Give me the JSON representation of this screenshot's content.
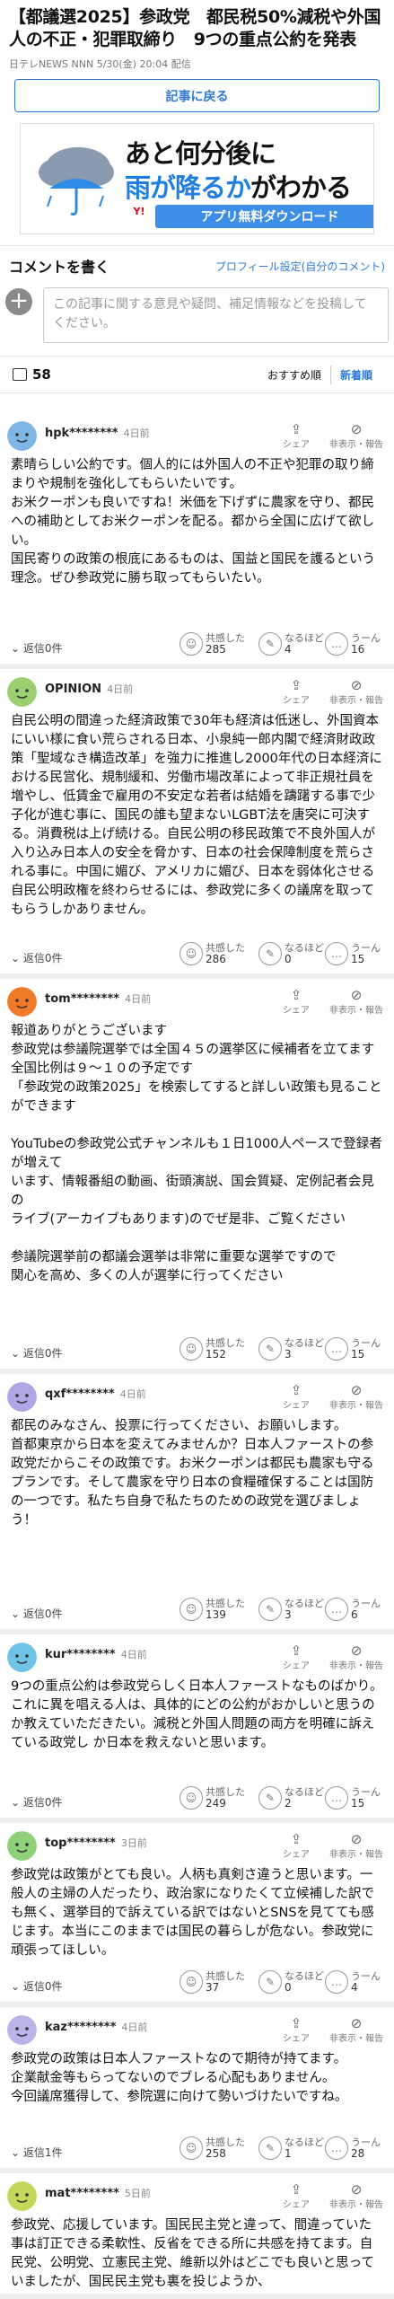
{
  "article": {
    "title": "【都議選2025】参政党　都民税50%減税や外国人の不正・犯罪取締り　9つの重点公約を発表",
    "source": "日テレNEWS NNN 5/30(金) 20:04 配信",
    "back_label": "記事に戻る"
  },
  "ad": {
    "line1": "あと何分後に",
    "line2_blue": "雨が降るか",
    "line2_rest": "がわかる",
    "logo_text": "Y!",
    "button": "アプリ無料ダウンロード"
  },
  "comment_section": {
    "heading": "コメントを書く",
    "profile_link": "プロフィール設定(自分のコメント)",
    "placeholder": "この記事に関する意見や疑問、補足情報などを投稿してください。",
    "count": "58",
    "sort_recommended": "おすすめ順",
    "sort_new": "新着順"
  },
  "labels": {
    "share": "シェア",
    "hide": "非表示・報告",
    "agree": "共感した",
    "think": "なるほど",
    "hmm": "うーん"
  },
  "comments": [
    {
      "user": "hpk********",
      "time": "4日前",
      "avatar_color": "#7fb6e6",
      "text": "素晴らしい公約です。個人的には外国人の不正や犯罪の取り締まりや規制を強化してもらいたいです。\nお米クーポンも良いですね！米価を下げずに農家を守り、都民への補助としてお米クーポンを配る。都から全国に広げて欲しい。\n国民寄りの政策の根底にあるものは、国益と国民を護るという理念。ぜひ参政党に勝ち取ってもらいたい。",
      "reply": "返信0件",
      "agree": "285",
      "think": "4",
      "hmm": "16"
    },
    {
      "user": "OPINION",
      "time": "4日前",
      "avatar_color": "#9ccf6f",
      "text": "自民公明の間違った経済政策で30年も経済は低迷し、外国資本にいい様に食い荒らされる日本、小泉純一郎内閣で経済財政政策「聖域なき構造改革」を強力に推進し2000年代の日本経済における民営化、規制緩和、労働市場改革によって非正規社員を増やし、低賃金で雇用の不安定な若者は結婚を躊躇する事で少子化が進む事に、国民の誰も望まないLGBT法を唐突に可決する。消費税は上げ続ける。自民公明の移民政策で不良外国人が入り込み日本人の安全を脅かす、日本の社会保障制度を荒らされる事に。中国に媚び、アメリカに媚び、日本を弱体化させる自民公明政権を終わらせるには、参政党に多くの議席を取ってもらうしかありません。",
      "reply": "返信0件",
      "agree": "286",
      "think": "0",
      "hmm": "15"
    },
    {
      "user": "tom********",
      "time": "4日前",
      "avatar_color": "#f07a2a",
      "text": "報道ありがとうございます\n参政党は参議院選挙では全国４５の選挙区に候補者を立てます\n全国比例は９～１０の予定です\n「参政党の政策2025」を検索してすると詳しい政策も見ることができます\n\nYouTubeの参政党公式チャンネルも１日1000人ペースで登録者が増えて\nいます、情報番組の動画、街頭演説、国会質疑、定例記者会見の\nライブ(アーカイブもあります)のでぜ是非、ご覧ください\n\n参議院選挙前の都議会選挙は非常に重要な選挙ですので\n関心を高め、多くの人が選挙に行ってください",
      "reply": "返信0件",
      "agree": "152",
      "think": "3",
      "hmm": "15"
    },
    {
      "user": "qxf********",
      "time": "4日前",
      "avatar_color": "#b0a6e6",
      "text": "都民のみなさん、投票に行ってください、お願いします。\n首都東京から日本を変えてみませんか？日本人ファーストの参政党だからこその政策です。お米クーポンは都民も農家も守るプランです。そして農家を守り日本の食糧確保することは国防の一つです。私たち自身で私たちのための政党を選びましょう！",
      "reply": "返信0件",
      "agree": "139",
      "think": "3",
      "hmm": "6"
    },
    {
      "user": "kur********",
      "time": "4日前",
      "avatar_color": "#6ec3e6",
      "text": "9つの重点公約は参政党らしく日本人ファーストなものばかり。これに異を唱える人は、具体的にどの公約がおかしいと思うのか教えていただきたい。減税と外国人問題の両方を明確に訴えている政党し か日本を救えないと思います。",
      "reply": "返信0件",
      "agree": "249",
      "think": "2",
      "hmm": "15"
    },
    {
      "user": "top********",
      "time": "3日前",
      "avatar_color": "#8fd07a",
      "text": "参政党は政策がとても良い。人柄も真剣さ違うと思います。一般人の主婦の人だったり、政治家になりたくて立候補した訳でも無く、選挙目的で訴えている訳ではないとSNSを見てても感じます。本当にこのままでは国民の暮らしが危ない。参政党に頑張ってほしい。",
      "reply": "返信0件",
      "agree": "37",
      "think": "0",
      "hmm": "4"
    },
    {
      "user": "kaz********",
      "time": "4日前",
      "avatar_color": "#b9b4e8",
      "text": "参政党の政策は日本人ファーストなので期待が持てます。\n企業献金等もらってないのでブレる心配もありません。\n今回議席獲得して、参院選に向けて勢いづけたいですね。",
      "reply": "返信1件",
      "agree": "258",
      "think": "1",
      "hmm": "28"
    },
    {
      "user": "mat********",
      "time": "5日前",
      "avatar_color": "#c6d65a",
      "text": "参政党、応援しています。国民民主党と違って、間違っていた事は訂正できる柔軟性、反省をできる所に共感を持てます。自民党、公明党、立憲民主党、維新以外はどこでも良いと思っていましたが、国民民主党も裏を投じようか、",
      "reply": "",
      "agree": "",
      "think": "",
      "hmm": ""
    }
  ]
}
